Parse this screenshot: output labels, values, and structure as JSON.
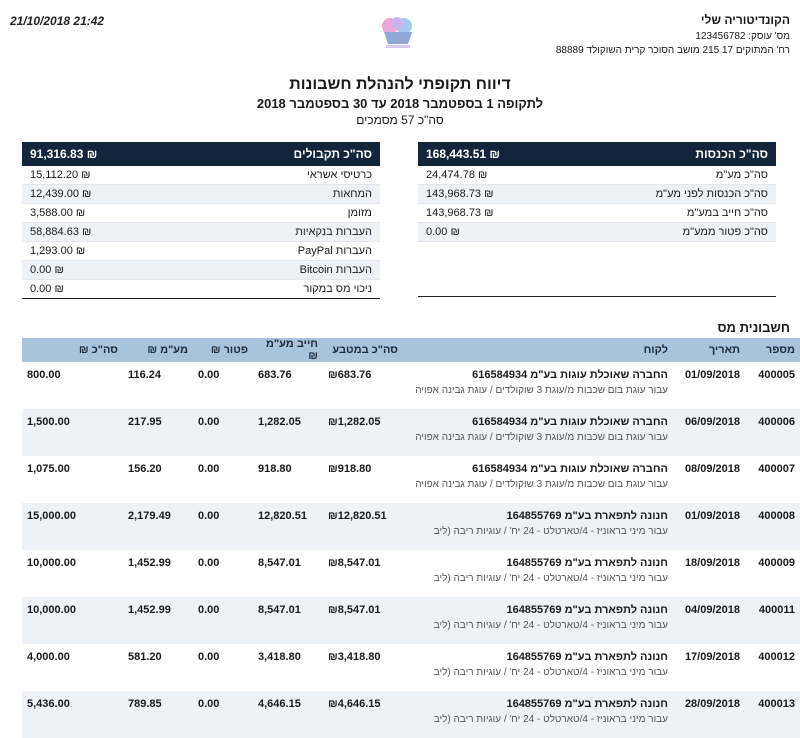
{
  "header": {
    "date": "21/10/2018 21:42",
    "business_name": "הקונדיטוריה שלי",
    "license": "מס' עוסק: 123456782",
    "address": "רח' המתוקים 17 215 מושב הסוכר קרית השוקולד 88889"
  },
  "report": {
    "title": "דיווח תקופתי להנהלת חשבונות",
    "period": "לתקופה 1 בספטמבר 2018 עד 30 בספטמבר 2018",
    "docs_count": "סה\"כ 57 מסמכים"
  },
  "income": {
    "header_label": "סה\"כ הכנסות",
    "header_value": "168,443.51 ₪",
    "rows": [
      {
        "label": "סה\"כ מע\"מ",
        "value": "24,474.78 ₪"
      },
      {
        "label": "סה\"כ הכנסות לפני מע\"מ",
        "value": "143,968.73 ₪"
      },
      {
        "label": "סה\"כ חייב במע\"מ",
        "value": "143,968.73 ₪"
      },
      {
        "label": "סה\"כ פטור ממע\"מ",
        "value": "0.00 ₪"
      }
    ]
  },
  "receipts": {
    "header_label": "סה\"כ תקבולים",
    "header_value": "91,316.83 ₪",
    "rows": [
      {
        "label": "כרטיסי אשראי",
        "value": "15,112.20 ₪"
      },
      {
        "label": "המחאות",
        "value": "12,439.00 ₪"
      },
      {
        "label": "מזומן",
        "value": "3,588.00 ₪"
      },
      {
        "label": "העברות בנקאיות",
        "value": "58,884.63 ₪"
      },
      {
        "label": "העברות PayPal",
        "value": "1,293.00 ₪"
      },
      {
        "label": "העברות Bitcoin",
        "value": "0.00 ₪"
      },
      {
        "label": "ניכוי מס במקור",
        "value": "0.00 ₪"
      }
    ]
  },
  "invoices": {
    "title": "חשבונית מס",
    "columns": [
      "מספר",
      "תאריך",
      "לקוח",
      "סה\"כ במטבע",
      "חייב מע\"מ ₪",
      "פטור ₪",
      "מע\"מ ₪",
      "סה\"כ ₪"
    ],
    "rows": [
      {
        "id": "400005",
        "date": "01/09/2018",
        "client": "החברה שאוכלת עוגות בע\"מ 616584934",
        "desc": "עבור עוגת בום שכבות מ/עוגת 3 שוקולדים / עוגת גבינה אפויה",
        "cur": "₪683.76",
        "vatable": "683.76",
        "exempt": "0.00",
        "vat": "116.24",
        "total": "800.00"
      },
      {
        "id": "400006",
        "date": "06/09/2018",
        "client": "החברה שאוכלת עוגות בע\"מ 616584934",
        "desc": "עבור עוגת בום שכבות מ/עוגת 3 שוקולדים / עוגת גבינה אפויה",
        "cur": "₪1,282.05",
        "vatable": "1,282.05",
        "exempt": "0.00",
        "vat": "217.95",
        "total": "1,500.00"
      },
      {
        "id": "400007",
        "date": "08/09/2018",
        "client": "החברה שאוכלת עוגות בע\"מ 616584934",
        "desc": "עבור עוגת בום שכבות מ/עוגת 3 שוקולדים / עוגת גבינה אפויה",
        "cur": "₪918.80",
        "vatable": "918.80",
        "exempt": "0.00",
        "vat": "156.20",
        "total": "1,075.00"
      },
      {
        "id": "400008",
        "date": "01/09/2018",
        "client": "חנונה לתפארת בע\"מ 164855769",
        "desc": "עבור מיני בראוניז - 4/טארטלט - 24 יח' / עוגיות ריבה (ליב",
        "cur": "₪12,820.51",
        "vatable": "12,820.51",
        "exempt": "0.00",
        "vat": "2,179.49",
        "total": "15,000.00"
      },
      {
        "id": "400009",
        "date": "18/09/2018",
        "client": "חנונה לתפארת בע\"מ 164855769",
        "desc": "עבור מיני בראוניז - 4/טארטלט - 24 יח' / עוגיות ריבה (ליב",
        "cur": "₪8,547.01",
        "vatable": "8,547.01",
        "exempt": "0.00",
        "vat": "1,452.99",
        "total": "10,000.00"
      },
      {
        "id": "400011",
        "date": "04/09/2018",
        "client": "חנונה לתפארת בע\"מ 164855769",
        "desc": "עבור מיני בראוניז - 4/טארטלט - 24 יח' / עוגיות ריבה (ליב",
        "cur": "₪8,547.01",
        "vatable": "8,547.01",
        "exempt": "0.00",
        "vat": "1,452.99",
        "total": "10,000.00"
      },
      {
        "id": "400012",
        "date": "17/09/2018",
        "client": "חנונה לתפארת בע\"מ 164855769",
        "desc": "עבור מיני בראוניז - 4/טארטלט - 24 יח' / עוגיות ריבה (ליב",
        "cur": "₪3,418.80",
        "vatable": "3,418.80",
        "exempt": "0.00",
        "vat": "581.20",
        "total": "4,000.00"
      },
      {
        "id": "400013",
        "date": "28/09/2018",
        "client": "חנונה לתפארת בע\"מ 164855769",
        "desc": "עבור מיני בראוניז - 4/טארטלט - 24 יח' / עוגיות ריבה (ליב",
        "cur": "₪4,646.15",
        "vatable": "4,646.15",
        "exempt": "0.00",
        "vat": "789.85",
        "total": "5,436.00"
      }
    ]
  }
}
